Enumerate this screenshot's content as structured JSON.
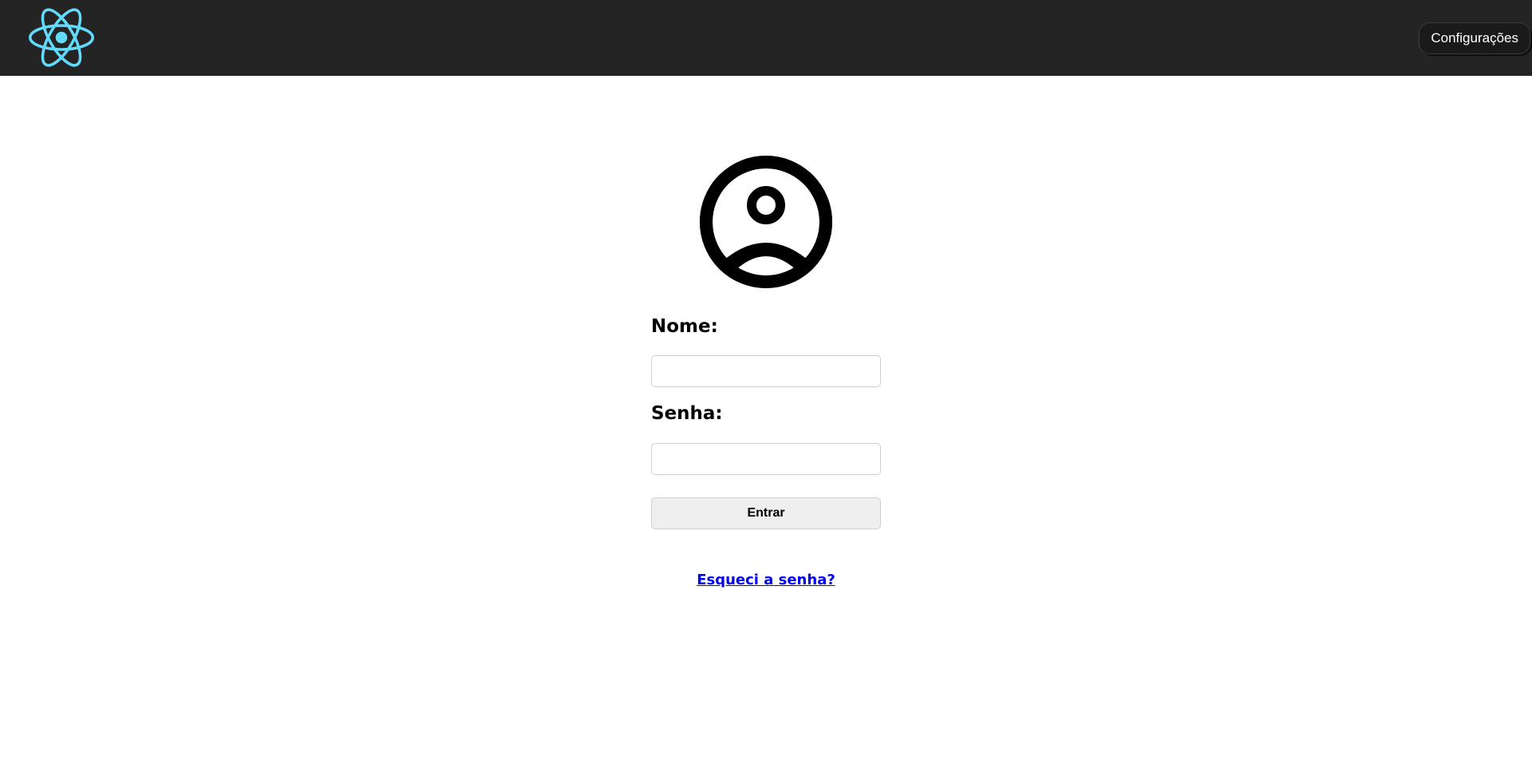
{
  "header": {
    "logo_icon": "react-atom-icon",
    "logo_color": "#61dafb",
    "settings_label": "Configurações"
  },
  "login": {
    "avatar_icon": "user-circle-icon",
    "name_label": "Nome:",
    "name_value": "",
    "password_label": "Senha:",
    "password_value": "",
    "submit_label": "Entrar",
    "forgot_link": "Esqueci a senha?"
  },
  "colors": {
    "header_bg": "#242424",
    "link": "#0000ee",
    "button_bg": "#efefef"
  }
}
